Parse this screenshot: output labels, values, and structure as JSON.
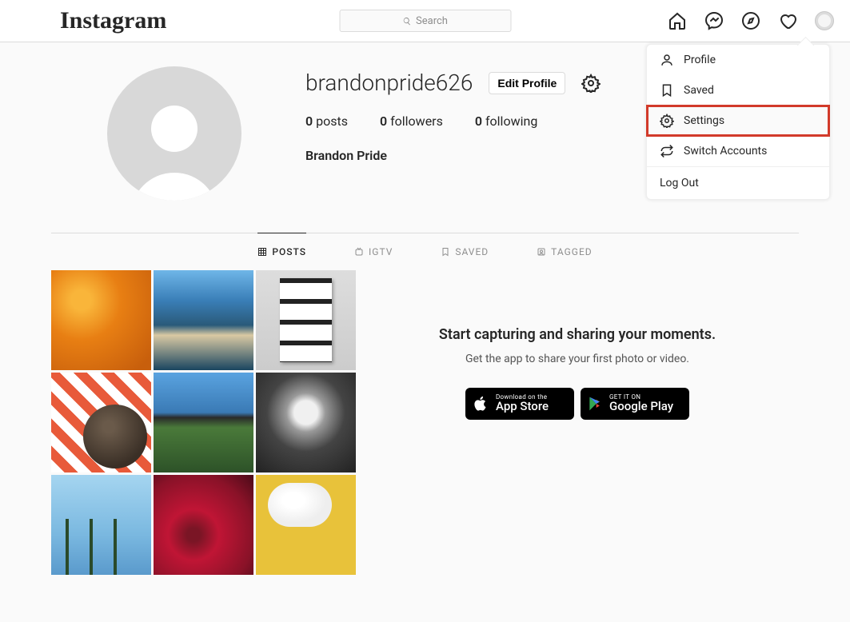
{
  "brand": "Instagram",
  "search": {
    "placeholder": "Search"
  },
  "profile": {
    "username": "brandonpride626",
    "edit_label": "Edit Profile",
    "display_name": "Brandon Pride",
    "stats": {
      "posts_count": "0",
      "posts_label": " posts",
      "followers_count": "0",
      "followers_label": " followers",
      "following_count": "0",
      "following_label": " following"
    }
  },
  "tabs": {
    "posts": "POSTS",
    "igtv": "IGTV",
    "saved": "SAVED",
    "tagged": "TAGGED"
  },
  "dropdown": {
    "profile": "Profile",
    "saved": "Saved",
    "settings": "Settings",
    "switch": "Switch Accounts",
    "logout": "Log Out"
  },
  "promo": {
    "headline": "Start capturing and sharing your moments.",
    "sub": "Get the app to share your first photo or video.",
    "appstore_l1": "Download on the",
    "appstore_l2": "App Store",
    "gplay_l1": "GET IT ON",
    "gplay_l2": "Google Play"
  }
}
